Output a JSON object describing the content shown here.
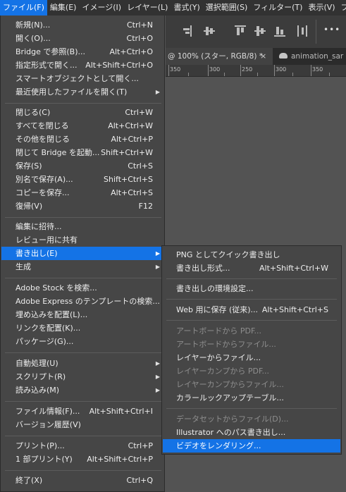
{
  "menubar": {
    "items": [
      {
        "label": "ファイル(F)",
        "active": true
      },
      {
        "label": "編集(E)"
      },
      {
        "label": "イメージ(I)"
      },
      {
        "label": "レイヤー(L)"
      },
      {
        "label": "書式(Y)"
      },
      {
        "label": "選択範囲(S)"
      },
      {
        "label": "フィルター(T)"
      },
      {
        "label": "表示(V)"
      },
      {
        "label": "プラ"
      }
    ]
  },
  "tabs": {
    "active": "@ 100% (スター, RGB/8) *",
    "close": "×",
    "second": "animation_sar"
  },
  "ruler": {
    "labels": [
      "350",
      "300",
      "250",
      "300",
      "350"
    ]
  },
  "file_menu": {
    "items": [
      {
        "label": "新規(N)...",
        "shortcut": "Ctrl+N"
      },
      {
        "label": "開く(O)...",
        "shortcut": "Ctrl+O"
      },
      {
        "label": "Bridge で参照(B)...",
        "shortcut": "Alt+Ctrl+O"
      },
      {
        "label": "指定形式で開く...",
        "shortcut": "Alt+Shift+Ctrl+O"
      },
      {
        "label": "スマートオブジェクトとして開く...",
        "shortcut": ""
      },
      {
        "label": "最近使用したファイルを開く(T)",
        "shortcut": "",
        "submenu": true
      },
      {
        "label": "閉じる(C)",
        "shortcut": "Ctrl+W"
      },
      {
        "label": "すべてを閉じる",
        "shortcut": "Alt+Ctrl+W"
      },
      {
        "label": "その他を閉じる",
        "shortcut": "Alt+Ctrl+P"
      },
      {
        "label": "閉じて Bridge を起動...",
        "shortcut": "Shift+Ctrl+W"
      },
      {
        "label": "保存(S)",
        "shortcut": "Ctrl+S"
      },
      {
        "label": "別名で保存(A)...",
        "shortcut": "Shift+Ctrl+S"
      },
      {
        "label": "コピーを保存...",
        "shortcut": "Alt+Ctrl+S"
      },
      {
        "label": "復帰(V)",
        "shortcut": "F12"
      },
      {
        "label": "編集に招待...",
        "shortcut": ""
      },
      {
        "label": "レビュー用に共有",
        "shortcut": ""
      },
      {
        "label": "書き出し(E)",
        "shortcut": "",
        "submenu": true,
        "highlighted": true
      },
      {
        "label": "生成",
        "shortcut": "",
        "submenu": true
      },
      {
        "label": "Adobe Stock を検索...",
        "shortcut": ""
      },
      {
        "label": "Adobe Express のテンプレートの検索...",
        "shortcut": ""
      },
      {
        "label": "埋め込みを配置(L)...",
        "shortcut": ""
      },
      {
        "label": "リンクを配置(K)...",
        "shortcut": ""
      },
      {
        "label": "パッケージ(G)...",
        "shortcut": ""
      },
      {
        "label": "自動処理(U)",
        "shortcut": "",
        "submenu": true
      },
      {
        "label": "スクリプト(R)",
        "shortcut": "",
        "submenu": true
      },
      {
        "label": "読み込み(M)",
        "shortcut": "",
        "submenu": true
      },
      {
        "label": "ファイル情報(F)...",
        "shortcut": "Alt+Shift+Ctrl+I"
      },
      {
        "label": "バージョン履歴(V)",
        "shortcut": ""
      },
      {
        "label": "プリント(P)...",
        "shortcut": "Ctrl+P"
      },
      {
        "label": "1 部プリント(Y)",
        "shortcut": "Alt+Shift+Ctrl+P"
      },
      {
        "label": "終了(X)",
        "shortcut": "Ctrl+Q"
      }
    ]
  },
  "export_menu": {
    "items": [
      {
        "label": "PNG としてクイック書き出し",
        "shortcut": ""
      },
      {
        "label": "書き出し形式...",
        "shortcut": "Alt+Shift+Ctrl+W"
      },
      {
        "label": "書き出しの環境設定...",
        "shortcut": ""
      },
      {
        "label": "Web 用に保存 (従来)...",
        "shortcut": "Alt+Shift+Ctrl+S"
      },
      {
        "label": "アートボードから PDF...",
        "shortcut": "",
        "disabled": true
      },
      {
        "label": "アートボードからファイル...",
        "shortcut": "",
        "disabled": true
      },
      {
        "label": "レイヤーからファイル...",
        "shortcut": ""
      },
      {
        "label": "レイヤーカンプから PDF...",
        "shortcut": "",
        "disabled": true
      },
      {
        "label": "レイヤーカンプからファイル...",
        "shortcut": "",
        "disabled": true
      },
      {
        "label": "カラールックアップテーブル...",
        "shortcut": ""
      },
      {
        "label": "データセットからファイル(D)...",
        "shortcut": "",
        "disabled": true
      },
      {
        "label": "Illustrator へのパス書き出し...",
        "shortcut": ""
      },
      {
        "label": "ビデオをレンダリング...",
        "shortcut": "",
        "highlighted": true
      }
    ]
  },
  "more_label": "•••"
}
